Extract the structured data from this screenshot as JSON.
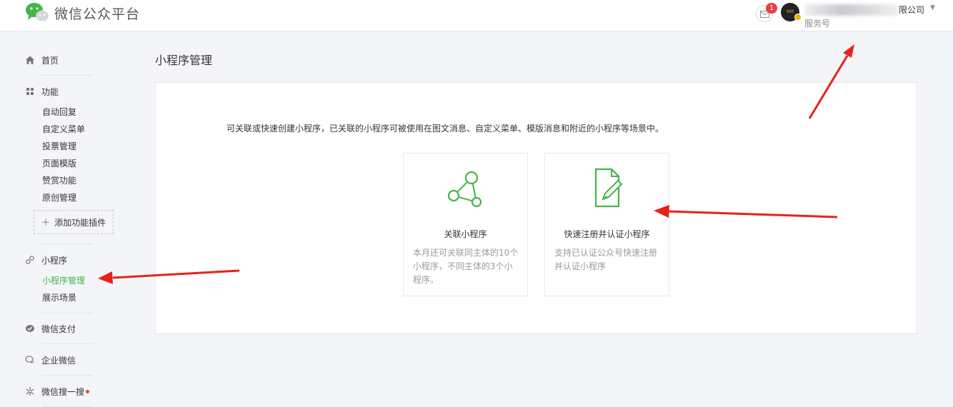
{
  "header": {
    "brand": "微信公众平台",
    "notification_count": "1",
    "avatar_text": "NM",
    "account_name_suffix": "限公司",
    "account_type": "服务号"
  },
  "sidebar": {
    "home": "首页",
    "features": "功能",
    "feature_items": [
      "自动回复",
      "自定义菜单",
      "投票管理",
      "页面模版",
      "赞赏功能",
      "原创管理"
    ],
    "add_plugin": "添加功能插件",
    "mini_program": "小程序",
    "mini_program_items": [
      "小程序管理",
      "展示场景"
    ],
    "pay": "微信支付",
    "work": "企业微信",
    "search": "微信搜一搜"
  },
  "main": {
    "title": "小程序管理",
    "description": "可关联或快速创建小程序，已关联的小程序可被使用在图文消息、自定义菜单、模版消息和附近的小程序等场景中。",
    "cards": [
      {
        "title": "关联小程序",
        "desc": "本月还可关联同主体的10个小程序，不同主体的3个小程序。",
        "icon": "link-nodes-icon"
      },
      {
        "title": "快速注册并认证小程序",
        "desc": "支持已认证公众号快速注册并认证小程序",
        "icon": "register-document-icon"
      }
    ]
  },
  "colors": {
    "accent": "#44b549",
    "badge": "#e64340",
    "arrow": "#e8221b"
  }
}
